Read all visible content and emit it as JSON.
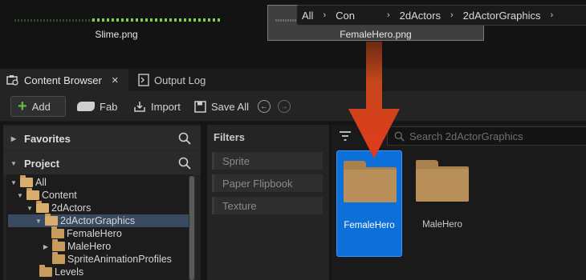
{
  "files": {
    "slime_label": "Slime.png",
    "femalehero_label": "FemaleHero.png"
  },
  "tabs": [
    {
      "label": "Content Browser",
      "icon": "content-browser-icon",
      "close": "×"
    },
    {
      "label": "Output Log",
      "icon": "output-log-icon"
    }
  ],
  "toolbar": {
    "add_label": "Add",
    "fab_label": "Fab",
    "import_label": "Import",
    "saveall_label": "Save All",
    "back_icon": "←",
    "forward_icon": "→"
  },
  "breadcrumb": {
    "items": [
      "All",
      "Con",
      "2dActors",
      "2dActorGraphics"
    ],
    "separator": "›"
  },
  "left": {
    "favorites": "Favorites",
    "project": "Project",
    "tree": [
      {
        "label": "All",
        "open": true
      },
      {
        "label": "Content",
        "open": true
      },
      {
        "label": "2dActors",
        "open": true
      },
      {
        "label": "2dActorGraphics",
        "open": true,
        "selected": true
      },
      {
        "label": "FemaleHero",
        "open": false
      },
      {
        "label": "MaleHero",
        "open": false
      },
      {
        "label": "SpriteAnimationProfiles",
        "open": false
      },
      {
        "label": "Levels",
        "open": false
      }
    ]
  },
  "filters": {
    "header": "Filters",
    "chips": [
      "Sprite",
      "Paper Flipbook",
      "Texture"
    ]
  },
  "content": {
    "search_placeholder": "Search 2dActorGraphics",
    "items": [
      {
        "label": "FemaleHero",
        "selected": true
      },
      {
        "label": "MaleHero",
        "selected": false
      }
    ]
  },
  "colors": {
    "accent_selected": "#0c70d8",
    "arrow": "#e0401c",
    "folder": "#b88e59",
    "add_plus": "#5fbf3f"
  }
}
